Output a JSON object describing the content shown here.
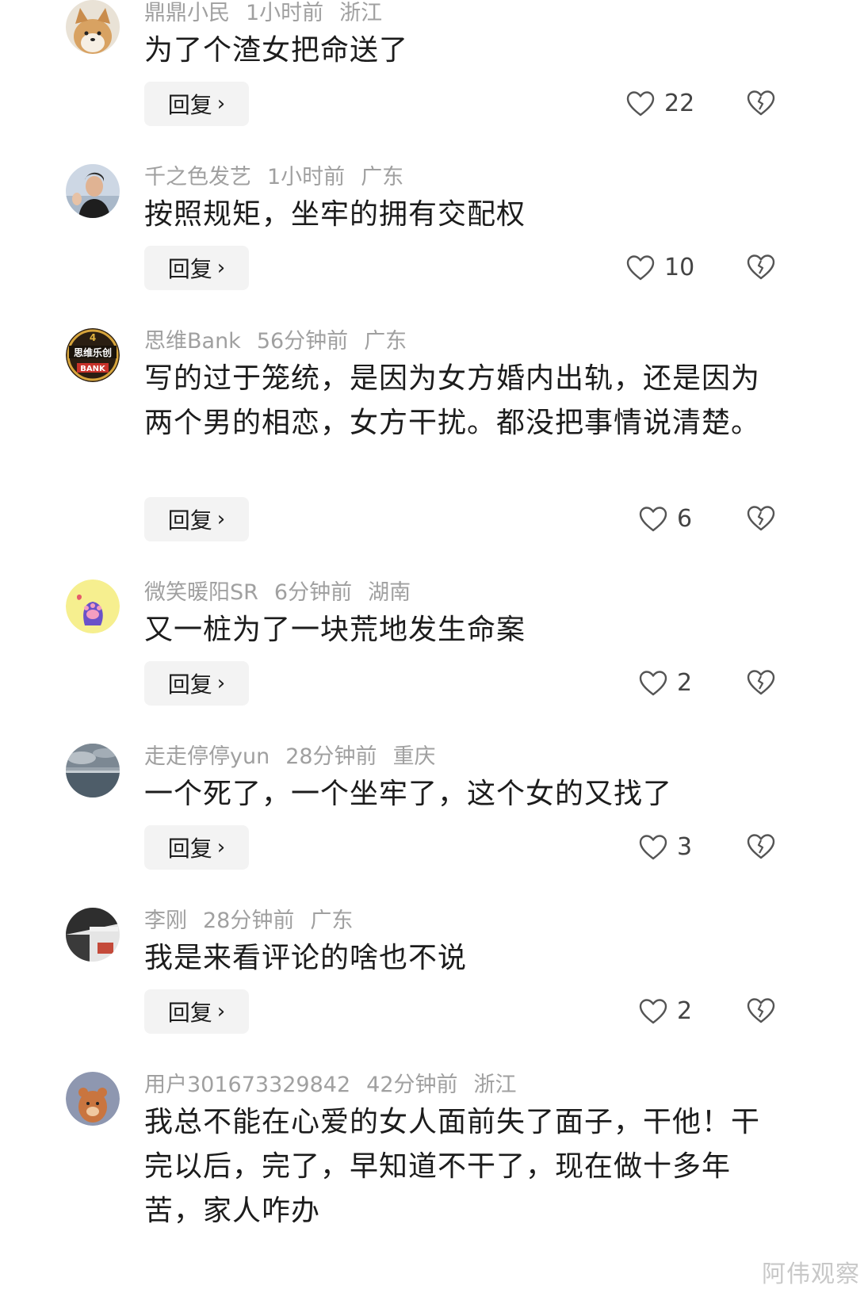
{
  "ui": {
    "reply_label": "回复",
    "reply_chevron": "›"
  },
  "comments": [
    {
      "username": "鼎鼎小民",
      "time": "1小时前",
      "location": "浙江",
      "text": "为了个渣女把命送了",
      "likes": "22",
      "avatar": "shiba-dog-avatar"
    },
    {
      "username": "千之色发艺",
      "time": "1小时前",
      "location": "广东",
      "text": "按照规矩，坐牢的拥有交配权",
      "likes": "10",
      "avatar": "man-photo-avatar"
    },
    {
      "username": "思维Bank",
      "time": "56分钟前",
      "location": "广东",
      "text": "写的过于笼统，是因为女方婚内出轨，还是因为两个男的相恋，女方干扰。都没把事情说清楚。",
      "likes": "6",
      "avatar": "bank-logo-avatar",
      "avatar_text": "思维乐创",
      "avatar_subtext": "BANK",
      "avatar_top": "4"
    },
    {
      "username": "微笑暖阳SR",
      "time": "6分钟前",
      "location": "湖南",
      "text": "又一桩为了一块荒地发生命案",
      "likes": "2",
      "avatar": "paw-avatar"
    },
    {
      "username": "走走停停yun",
      "time": "28分钟前",
      "location": "重庆",
      "text": "一个死了，一个坐牢了，这个女的又找了",
      "likes": "3",
      "avatar": "sea-sky-avatar"
    },
    {
      "username": "李刚",
      "time": "28分钟前",
      "location": "广东",
      "text": "我是来看评论的啥也不说",
      "likes": "2",
      "avatar": "room-photo-avatar"
    },
    {
      "username": "用户301673329842",
      "time": "42分钟前",
      "location": "浙江",
      "text": "我总不能在心爱的女人面前失了面子，干他！干完以后，完了，早知道不干了，现在做十多年苦，家人咋办",
      "avatar": "bear-avatar"
    }
  ],
  "watermark": "阿伟观察",
  "colors": {
    "meta_text": "#a0a0a0",
    "body_text": "#1c1c1c",
    "reply_bg": "#f3f3f3",
    "icon": "#555555"
  }
}
